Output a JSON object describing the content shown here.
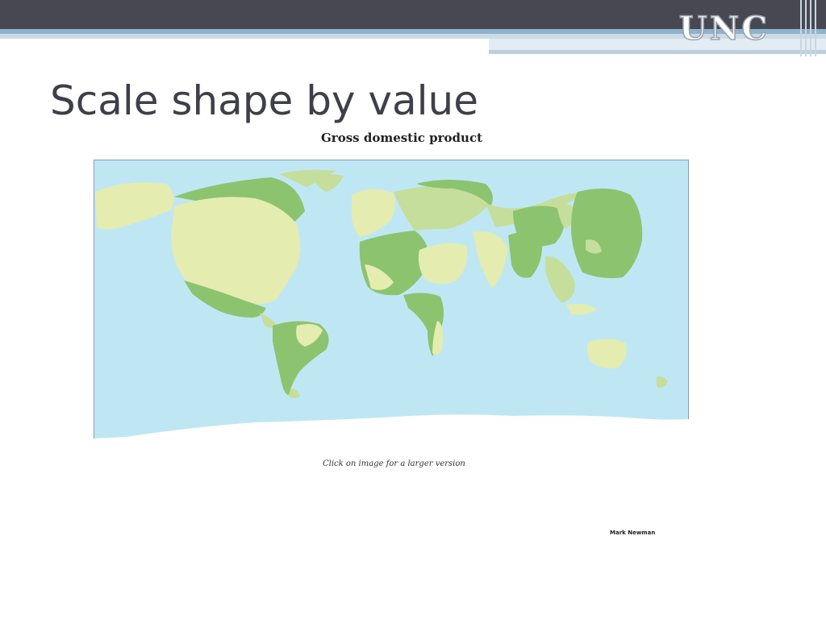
{
  "header": {
    "logo_text": "UNC"
  },
  "slide": {
    "title": "Scale shape by value"
  },
  "map": {
    "title": "Gross domestic product",
    "caption": "Click on image for a larger version",
    "credit": "Mark Newman",
    "colors": {
      "ocean": "#bfe7f3",
      "border": "#8a98c8",
      "land_light": "#e4ecb0",
      "land_mid": "#c5de9c",
      "land_dark": "#8cc36f",
      "antarctica": "#ffffff"
    }
  }
}
